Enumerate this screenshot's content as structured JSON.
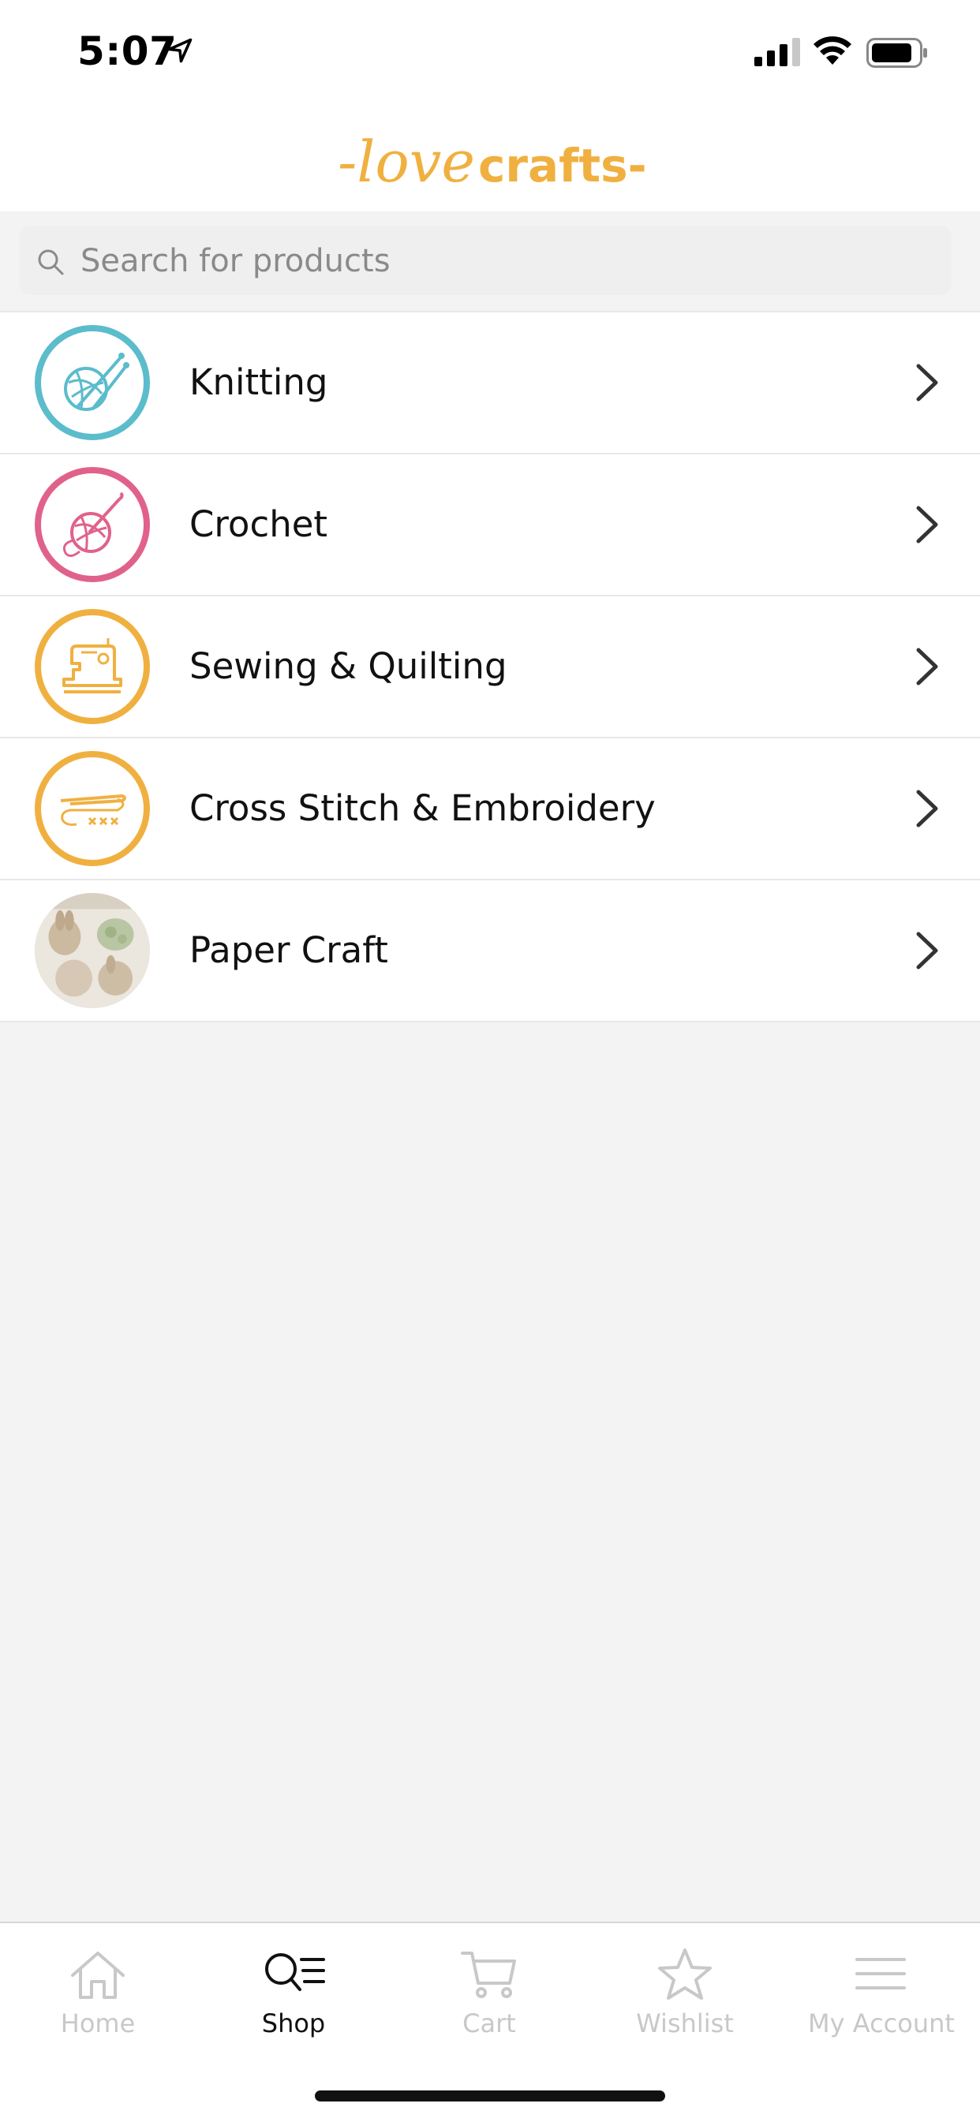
{
  "status": {
    "time": "5:07"
  },
  "brand": {
    "part1": "-love",
    "part2": "crafts-",
    "color": "#f0b040"
  },
  "search": {
    "placeholder": "Search for products"
  },
  "categories": [
    {
      "label": "Knitting",
      "icon": "knitting-yarn-icon",
      "ring_color": "#5bbccc"
    },
    {
      "label": "Crochet",
      "icon": "crochet-yarn-icon",
      "ring_color": "#e0628a"
    },
    {
      "label": "Sewing & Quilting",
      "icon": "sewing-machine-icon",
      "ring_color": "#f0b040"
    },
    {
      "label": "Cross Stitch & Embroidery",
      "icon": "needle-thread-icon",
      "ring_color": "#f0b040"
    },
    {
      "label": "Paper Craft",
      "icon": "paper-craft-photo",
      "ring_color": "#e6e6e6"
    }
  ],
  "tabbar": {
    "items": [
      {
        "label": "Home",
        "icon": "home-icon",
        "active": false
      },
      {
        "label": "Shop",
        "icon": "shop-search-icon",
        "active": true
      },
      {
        "label": "Cart",
        "icon": "cart-icon",
        "active": false
      },
      {
        "label": "Wishlist",
        "icon": "star-icon",
        "active": false
      },
      {
        "label": "My Account",
        "icon": "menu-icon",
        "active": false
      }
    ]
  }
}
